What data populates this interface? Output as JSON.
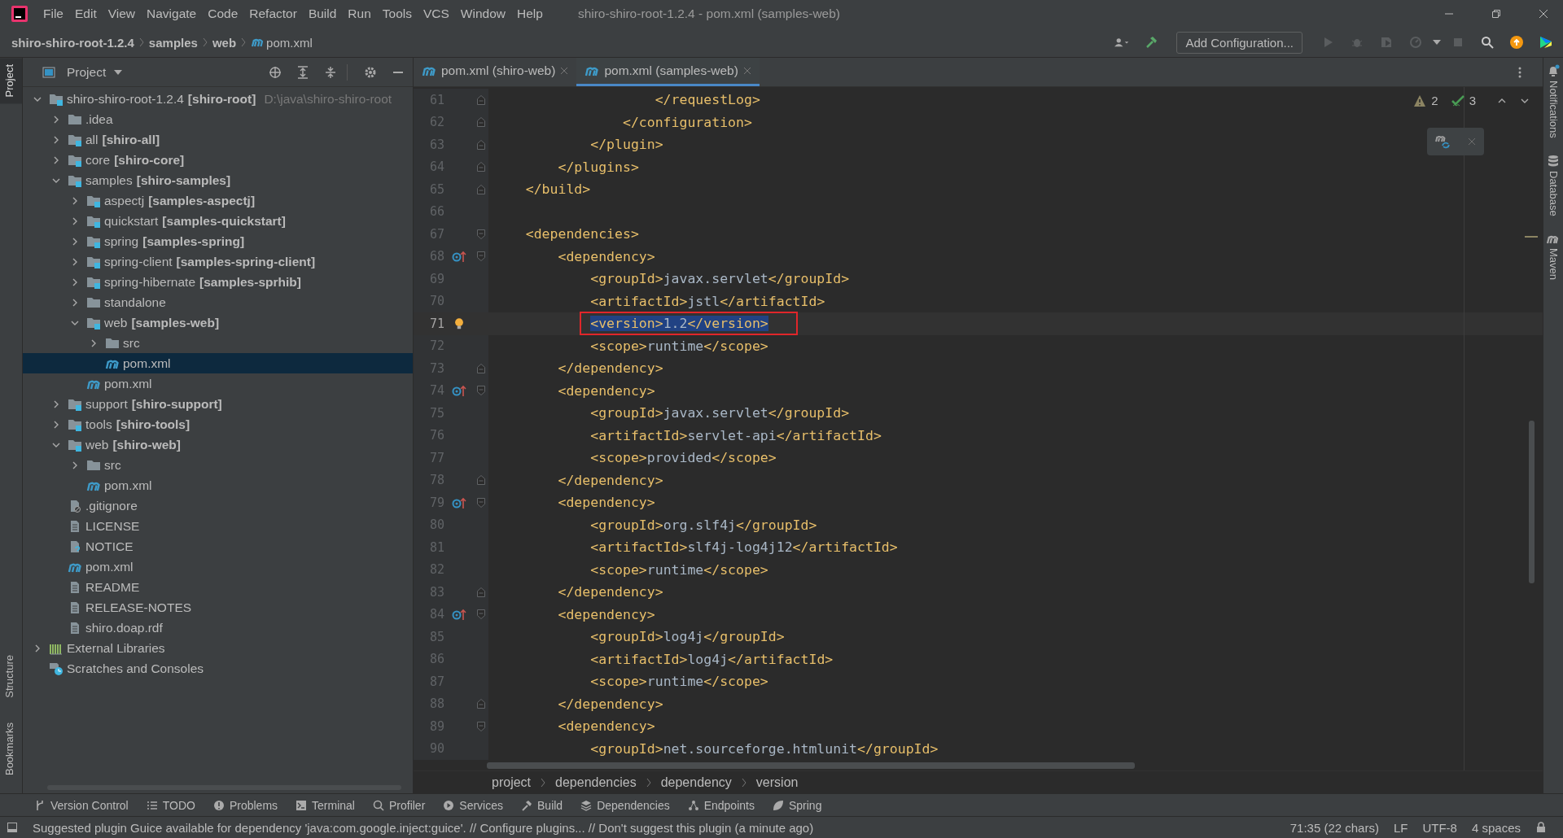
{
  "window": {
    "title": "shiro-shiro-root-1.2.4 - pom.xml (samples-web)"
  },
  "menu": [
    "File",
    "Edit",
    "View",
    "Navigate",
    "Code",
    "Refactor",
    "Build",
    "Run",
    "Tools",
    "VCS",
    "Window",
    "Help"
  ],
  "nav_path": [
    {
      "label": "shiro-shiro-root-1.2.4",
      "kind": "folder"
    },
    {
      "label": "samples",
      "kind": "folder"
    },
    {
      "label": "web",
      "kind": "folder"
    },
    {
      "label": "pom.xml",
      "kind": "maven"
    }
  ],
  "toolbar": {
    "run_config": "Add Configuration..."
  },
  "left_strip": [
    {
      "label": "Project",
      "selected": true
    },
    {
      "label": "Structure",
      "selected": false
    },
    {
      "label": "Bookmarks",
      "selected": false
    }
  ],
  "right_strip": [
    {
      "label": "Notifications",
      "kind": "bell"
    },
    {
      "label": "Database",
      "kind": "database"
    },
    {
      "label": "Maven",
      "kind": "maven"
    }
  ],
  "project": {
    "title": "Project",
    "tree": [
      {
        "label": "shiro-shiro-root-1.2.4",
        "module": "[shiro-root]",
        "path": "D:\\java\\shiro-shiro-root",
        "kind": "module",
        "expanded": true,
        "selected": false,
        "children": [
          {
            "label": ".idea",
            "kind": "folder",
            "expanded": false,
            "selected": false
          },
          {
            "label": "all",
            "module": "[shiro-all]",
            "kind": "module",
            "expanded": false,
            "selected": false
          },
          {
            "label": "core",
            "module": "[shiro-core]",
            "kind": "module",
            "expanded": false,
            "selected": false
          },
          {
            "label": "samples",
            "module": "[shiro-samples]",
            "kind": "module",
            "expanded": true,
            "selected": false,
            "children": [
              {
                "label": "aspectj",
                "module": "[samples-aspectj]",
                "kind": "module",
                "expanded": false,
                "selected": false
              },
              {
                "label": "quickstart",
                "module": "[samples-quickstart]",
                "kind": "module",
                "expanded": false,
                "selected": false
              },
              {
                "label": "spring",
                "module": "[samples-spring]",
                "kind": "module",
                "expanded": false,
                "selected": false
              },
              {
                "label": "spring-client",
                "module": "[samples-spring-client]",
                "kind": "module",
                "expanded": false,
                "selected": false
              },
              {
                "label": "spring-hibernate",
                "module": "[samples-sprhib]",
                "kind": "module",
                "expanded": false,
                "selected": false
              },
              {
                "label": "standalone",
                "kind": "folder",
                "expanded": false,
                "selected": false
              },
              {
                "label": "web",
                "module": "[samples-web]",
                "kind": "module",
                "expanded": true,
                "selected": false,
                "children": [
                  {
                    "label": "src",
                    "kind": "folder",
                    "expanded": false,
                    "selected": false
                  },
                  {
                    "label": "pom.xml",
                    "kind": "maven",
                    "selected": true
                  }
                ]
              },
              {
                "label": "pom.xml",
                "kind": "maven",
                "selected": false
              }
            ]
          },
          {
            "label": "support",
            "module": "[shiro-support]",
            "kind": "module",
            "expanded": false,
            "selected": false
          },
          {
            "label": "tools",
            "module": "[shiro-tools]",
            "kind": "module",
            "expanded": false,
            "selected": false
          },
          {
            "label": "web",
            "module": "[shiro-web]",
            "kind": "module",
            "expanded": true,
            "selected": false,
            "children": [
              {
                "label": "src",
                "kind": "folder",
                "expanded": false,
                "selected": false
              },
              {
                "label": "pom.xml",
                "kind": "maven",
                "selected": false
              }
            ]
          },
          {
            "label": ".gitignore",
            "kind": "ignore",
            "selected": false
          },
          {
            "label": "LICENSE",
            "kind": "text",
            "selected": false
          },
          {
            "label": "NOTICE",
            "kind": "unknown",
            "selected": false
          },
          {
            "label": "pom.xml",
            "kind": "maven",
            "selected": false
          },
          {
            "label": "README",
            "kind": "text",
            "selected": false
          },
          {
            "label": "RELEASE-NOTES",
            "kind": "text",
            "selected": false
          },
          {
            "label": "shiro.doap.rdf",
            "kind": "text",
            "selected": false
          }
        ]
      },
      {
        "label": "External Libraries",
        "kind": "libraries",
        "expanded": false,
        "selected": false
      },
      {
        "label": "Scratches and Consoles",
        "kind": "scratches",
        "selected": false
      }
    ]
  },
  "tabs": [
    {
      "label": "pom.xml (shiro-web)",
      "selected": false
    },
    {
      "label": "pom.xml (samples-web)",
      "selected": true
    }
  ],
  "inspections": {
    "warnings": "2",
    "checks": "3"
  },
  "editor": {
    "annotation_box": true,
    "lines": [
      {
        "number": "61",
        "text": "                    </requestLog>",
        "fold_end": true,
        "selected": false
      },
      {
        "number": "62",
        "text": "                </configuration>",
        "fold_end": true,
        "selected": false
      },
      {
        "number": "63",
        "text": "            </plugin>",
        "fold_end": true,
        "selected": false
      },
      {
        "number": "64",
        "text": "        </plugins>",
        "fold_end": true,
        "selected": false
      },
      {
        "number": "65",
        "text": "    </build>",
        "fold_end": true,
        "selected": false
      },
      {
        "number": "66",
        "selected": false
      },
      {
        "number": "67",
        "text": "    <dependencies>",
        "fold_start": true,
        "selected": false
      },
      {
        "number": "68",
        "text": "        <dependency>",
        "fold_start": true,
        "override_marker": true,
        "selected": false
      },
      {
        "number": "69",
        "text": "            <groupId>javax.servlet</groupId>",
        "selected": false
      },
      {
        "number": "70",
        "text": "            <artifactId>jstl</artifactId>",
        "selected": false
      },
      {
        "number": "71",
        "text": "            <version>1.2</version>",
        "selected": true,
        "bulb": true
      },
      {
        "number": "72",
        "text": "            <scope>runtime</scope>",
        "selected": false
      },
      {
        "number": "73",
        "text": "        </dependency>",
        "fold_end": true,
        "selected": false
      },
      {
        "number": "74",
        "text": "        <dependency>",
        "fold_start": true,
        "override_marker": true,
        "selected": false
      },
      {
        "number": "75",
        "text": "            <groupId>javax.servlet</groupId>",
        "selected": false
      },
      {
        "number": "76",
        "text": "            <artifactId>servlet-api</artifactId>",
        "selected": false
      },
      {
        "number": "77",
        "text": "            <scope>provided</scope>",
        "selected": false
      },
      {
        "number": "78",
        "text": "        </dependency>",
        "fold_end": true,
        "selected": false
      },
      {
        "number": "79",
        "text": "        <dependency>",
        "fold_start": true,
        "override_marker": true,
        "selected": false
      },
      {
        "number": "80",
        "text": "            <groupId>org.slf4j</groupId>",
        "selected": false
      },
      {
        "number": "81",
        "text": "            <artifactId>slf4j-log4j12</artifactId>",
        "selected": false
      },
      {
        "number": "82",
        "text": "            <scope>runtime</scope>",
        "selected": false
      },
      {
        "number": "83",
        "text": "        </dependency>",
        "fold_end": true,
        "selected": false
      },
      {
        "number": "84",
        "text": "        <dependency>",
        "fold_start": true,
        "override_marker": true,
        "selected": false
      },
      {
        "number": "85",
        "text": "            <groupId>log4j</groupId>",
        "selected": false
      },
      {
        "number": "86",
        "text": "            <artifactId>log4j</artifactId>",
        "selected": false
      },
      {
        "number": "87",
        "text": "            <scope>runtime</scope>",
        "selected": false
      },
      {
        "number": "88",
        "text": "        </dependency>",
        "fold_end": true,
        "selected": false
      },
      {
        "number": "89",
        "text": "        <dependency>",
        "fold_start": true,
        "selected": false
      },
      {
        "number": "90",
        "text": "            <groupId>net.sourceforge.htmlunit</groupId>",
        "selected": false
      }
    ]
  },
  "editor_breadcrumbs": [
    "project",
    "dependencies",
    "dependency",
    "version"
  ],
  "tool_windows": [
    {
      "label": "Version Control",
      "kind": "vcs"
    },
    {
      "label": "TODO",
      "kind": "list"
    },
    {
      "label": "Problems",
      "kind": "problems"
    },
    {
      "label": "Terminal",
      "kind": "terminal"
    },
    {
      "label": "Profiler",
      "kind": "profiler"
    },
    {
      "label": "Services",
      "kind": "services"
    },
    {
      "label": "Build",
      "kind": "build"
    },
    {
      "label": "Dependencies",
      "kind": "dependencies"
    },
    {
      "label": "Endpoints",
      "kind": "endpoints"
    },
    {
      "label": "Spring",
      "kind": "spring"
    }
  ],
  "status_bar": {
    "message": "Suggested plugin Guice available for dependency 'java:com.google.inject:guice'. // Configure plugins... // Don't suggest this plugin (a minute ago)",
    "position": "71:35 (22 chars)",
    "line_separator": "LF",
    "encoding": "UTF-8",
    "indent": "4 spaces"
  }
}
